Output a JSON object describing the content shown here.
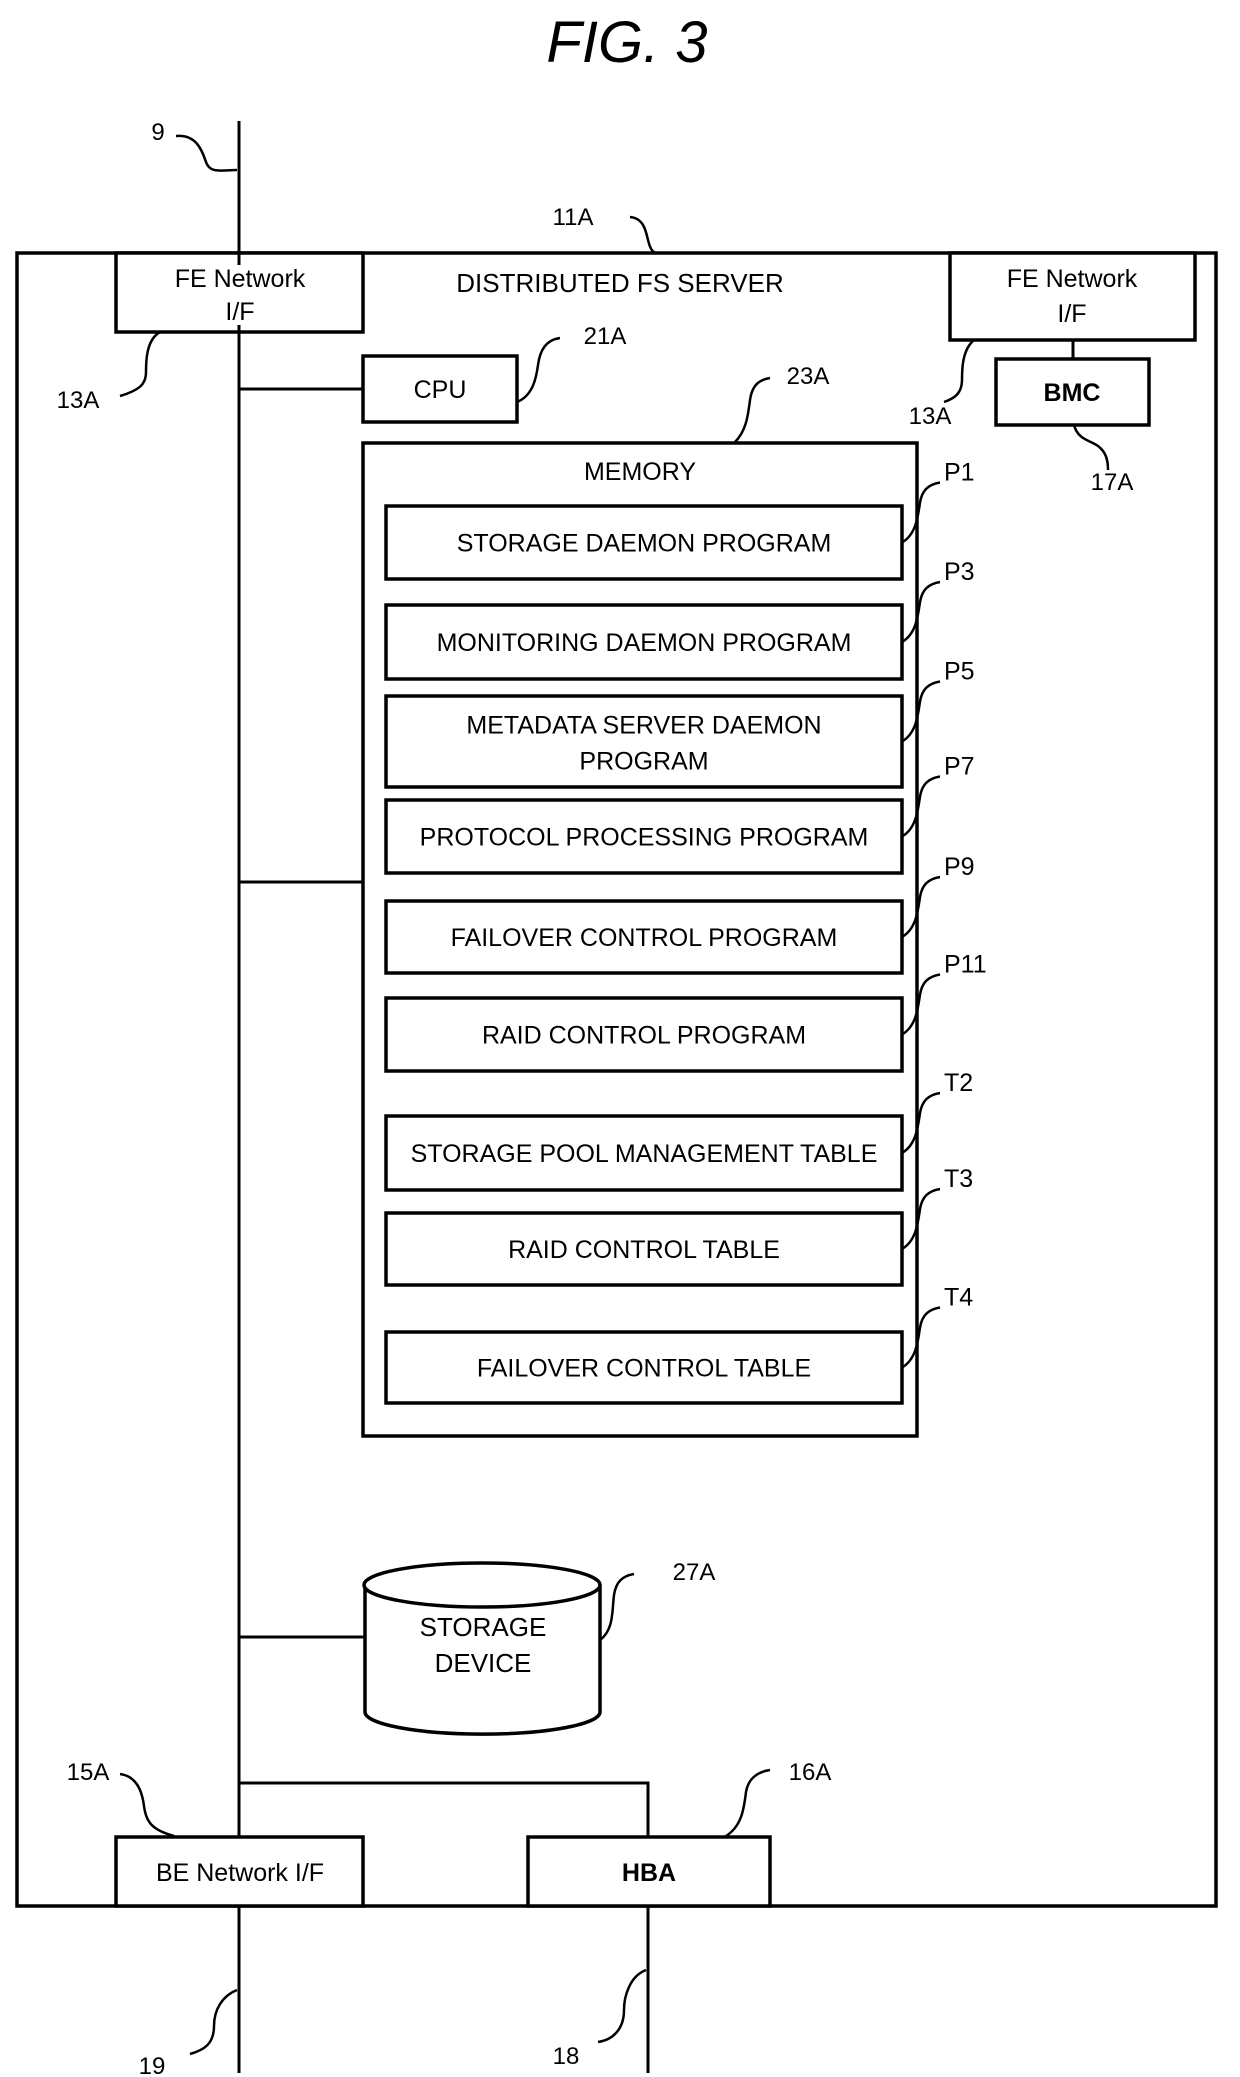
{
  "figure": {
    "title": "FIG. 3",
    "server": {
      "label": "DISTRIBUTED FS SERVER",
      "ref": "11A"
    },
    "network_ref": "9",
    "fe_nif_left": {
      "line1": "FE Network",
      "line2": "I/F",
      "ref": "13A"
    },
    "fe_nif_right": {
      "line1": "FE Network",
      "line2": "I/F",
      "ref": "13A"
    },
    "bmc": {
      "label": "BMC",
      "ref": "17A"
    },
    "cpu": {
      "label": "CPU",
      "ref": "21A"
    },
    "memory": {
      "label": "MEMORY",
      "ref": "23A",
      "items": [
        {
          "line1": "STORAGE DAEMON PROGRAM",
          "line2": "",
          "ref": "P1"
        },
        {
          "line1": "MONITORING DAEMON PROGRAM",
          "line2": "",
          "ref": "P3"
        },
        {
          "line1": "METADATA SERVER DAEMON",
          "line2": "PROGRAM",
          "ref": "P5"
        },
        {
          "line1": "PROTOCOL PROCESSING PROGRAM",
          "line2": "",
          "ref": "P7"
        },
        {
          "line1": "FAILOVER CONTROL PROGRAM",
          "line2": "",
          "ref": "P9"
        },
        {
          "line1": "RAID CONTROL PROGRAM",
          "line2": "",
          "ref": "P11"
        },
        {
          "line1": "STORAGE POOL MANAGEMENT TABLE",
          "line2": "",
          "ref": "T2"
        },
        {
          "line1": "RAID CONTROL TABLE",
          "line2": "",
          "ref": "T3"
        },
        {
          "line1": "FAILOVER CONTROL TABLE",
          "line2": "",
          "ref": "T4"
        }
      ]
    },
    "storage_device": {
      "line1": "STORAGE",
      "line2": "DEVICE",
      "ref": "27A"
    },
    "be_nif": {
      "label": "BE Network I/F",
      "ref": "15A"
    },
    "hba": {
      "label": "HBA",
      "ref": "16A"
    },
    "be_network_ref": "19",
    "storage_network_ref": "18"
  }
}
